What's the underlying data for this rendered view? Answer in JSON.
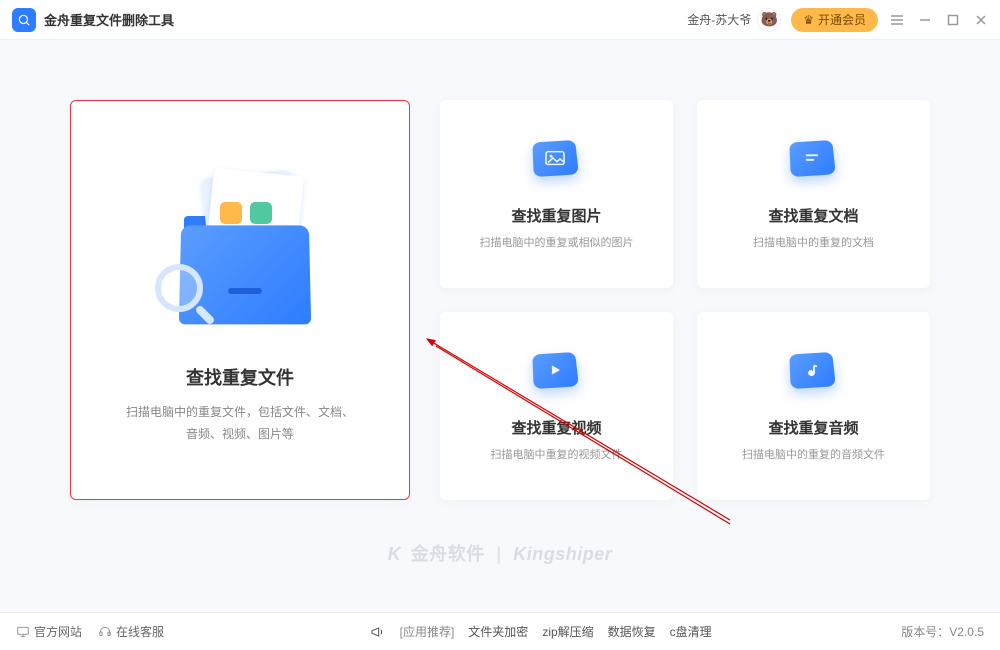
{
  "titlebar": {
    "app_title": "金舟重复文件删除工具",
    "user_name": "金舟-苏大爷",
    "vip_btn": "开通会员"
  },
  "main_card": {
    "title": "查找重复文件",
    "desc_line1": "扫描电脑中的重复文件，包括文件、文档、",
    "desc_line2": "音频、视频、图片等"
  },
  "cards": [
    {
      "title": "查找重复图片",
      "desc": "扫描电脑中的重复或相似的图片"
    },
    {
      "title": "查找重复文档",
      "desc": "扫描电脑中的重复的文档"
    },
    {
      "title": "查找重复视频",
      "desc": "扫描电脑中重复的视频文件"
    },
    {
      "title": "查找重复音频",
      "desc": "扫描电脑中的重复的音频文件"
    }
  ],
  "watermark": {
    "left": "金舟软件",
    "right": "Kingshiper"
  },
  "footer": {
    "site": "官方网站",
    "support": "在线客服",
    "rec_label": "[应用推荐]",
    "items": [
      "文件夹加密",
      "zip解压缩",
      "数据恢复",
      "c盘清理"
    ],
    "version_label": "版本号：",
    "version": "V2.0.5"
  }
}
